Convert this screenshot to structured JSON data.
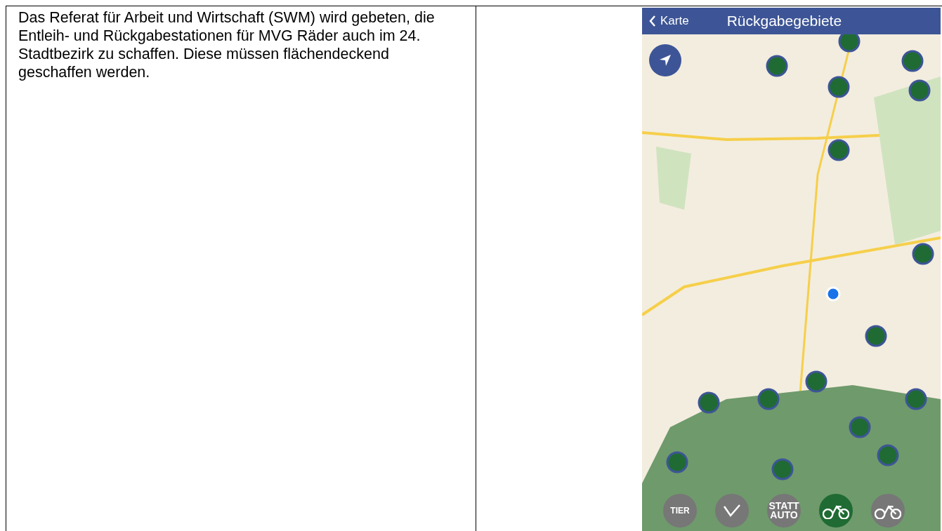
{
  "document": {
    "paragraph": "Das Referat für Arbeit und Wirtschaft (SWM) wird gebeten, die Entleih- und Rückgabestationen für MVG Räder auch im 24. Stadtbezirk zu schaffen. Diese müssen flächendeckend geschaffen werden."
  },
  "app": {
    "back_label": "Karte",
    "title": "Rückgabegebiete",
    "mode_buttons": [
      {
        "kind": "text",
        "label": "TIER",
        "selected": false
      },
      {
        "kind": "logo",
        "selected": false
      },
      {
        "kind": "text",
        "label": "STATT AUTO",
        "selected": false
      },
      {
        "kind": "bike",
        "selected": true
      },
      {
        "kind": "ebike",
        "selected": false
      }
    ]
  }
}
